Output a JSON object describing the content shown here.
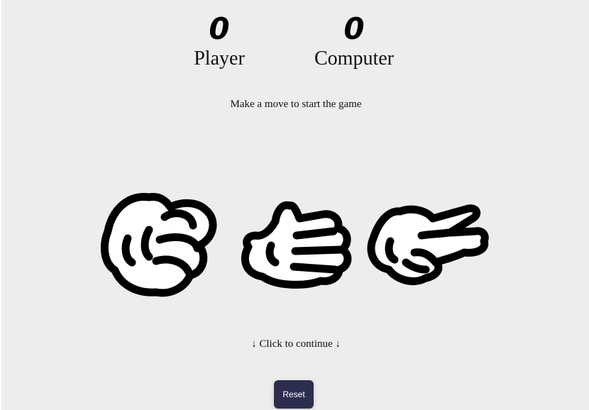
{
  "scoreboard": {
    "player": {
      "score": "0",
      "label": "Player"
    },
    "computer": {
      "score": "0",
      "label": "Computer"
    }
  },
  "status_text": "Make a move to start the game",
  "moves": [
    {
      "name": "rock",
      "icon": "rock-hand-icon"
    },
    {
      "name": "paper",
      "icon": "paper-hand-icon"
    },
    {
      "name": "scissors",
      "icon": "scissors-hand-icon"
    }
  ],
  "continue_text": "↓ Click to continue ↓",
  "reset_label": "Reset",
  "colors": {
    "background": "#ededed",
    "button": "#2d2d4f",
    "button_text": "#ffffff"
  }
}
